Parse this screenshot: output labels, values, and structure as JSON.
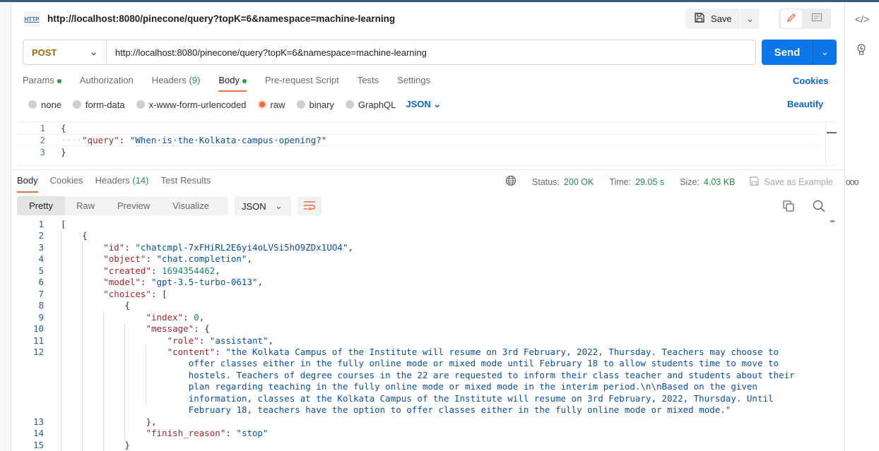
{
  "request": {
    "title": "http://localhost:8080/pinecone/query?topK=6&namespace=machine-learning",
    "method": "POST",
    "url": "http://localhost:8080/pinecone/query?topK=6&namespace=machine-learning",
    "save_label": "Save",
    "send_label": "Send",
    "tabs": [
      {
        "label": "Params",
        "dot": true
      },
      {
        "label": "Authorization"
      },
      {
        "label": "Headers",
        "count": "(9)"
      },
      {
        "label": "Body",
        "dot": true,
        "active": true
      },
      {
        "label": "Pre-request Script"
      },
      {
        "label": "Tests"
      },
      {
        "label": "Settings"
      }
    ],
    "cookies_label": "Cookies",
    "body_types": [
      "none",
      "form-data",
      "x-www-form-urlencoded",
      "raw",
      "binary",
      "GraphQL"
    ],
    "body_type_selected": "raw",
    "body_format": "JSON",
    "beautify_label": "Beautify",
    "body_lines": [
      {
        "n": "1",
        "tokens": [
          {
            "t": "{",
            "c": "p"
          }
        ]
      },
      {
        "n": "2",
        "tokens": [
          {
            "t": "····",
            "c": "g"
          },
          {
            "t": "\"query\"",
            "c": "k"
          },
          {
            "t": ": ",
            "c": "p"
          },
          {
            "t": "\"When·is·the·Kolkata·campus·opening?\"",
            "c": "s"
          }
        ]
      },
      {
        "n": "3",
        "tokens": [
          {
            "t": "}",
            "c": "p"
          }
        ]
      }
    ]
  },
  "response": {
    "tabs": [
      {
        "label": "Body",
        "active": true
      },
      {
        "label": "Cookies"
      },
      {
        "label": "Headers",
        "count": "(14)"
      },
      {
        "label": "Test Results"
      }
    ],
    "status_label": "Status:",
    "status": "200 OK",
    "time_label": "Time:",
    "time": "29.05 s",
    "size_label": "Size:",
    "size": "4.03 KB",
    "save_example_label": "Save as Example",
    "views": [
      "Pretty",
      "Raw",
      "Preview",
      "Visualize"
    ],
    "active_view": "Pretty",
    "format": "JSON",
    "lines": [
      {
        "n": "1",
        "i": 0,
        "tokens": [
          {
            "t": "[",
            "c": "p"
          }
        ]
      },
      {
        "n": "2",
        "i": 1,
        "tokens": [
          {
            "t": "{",
            "c": "p"
          }
        ]
      },
      {
        "n": "3",
        "i": 2,
        "tokens": [
          {
            "t": "\"id\"",
            "c": "k"
          },
          {
            "t": ": ",
            "c": "p"
          },
          {
            "t": "\"chatcmpl-7xFHiRL2E6yi4oLVSi5hO9ZDx1UO4\"",
            "c": "s"
          },
          {
            "t": ",",
            "c": "p"
          }
        ]
      },
      {
        "n": "4",
        "i": 2,
        "tokens": [
          {
            "t": "\"object\"",
            "c": "k"
          },
          {
            "t": ": ",
            "c": "p"
          },
          {
            "t": "\"chat.completion\"",
            "c": "s"
          },
          {
            "t": ",",
            "c": "p"
          }
        ]
      },
      {
        "n": "5",
        "i": 2,
        "tokens": [
          {
            "t": "\"created\"",
            "c": "k"
          },
          {
            "t": ": ",
            "c": "p"
          },
          {
            "t": "1694354462",
            "c": "n"
          },
          {
            "t": ",",
            "c": "p"
          }
        ]
      },
      {
        "n": "6",
        "i": 2,
        "tokens": [
          {
            "t": "\"model\"",
            "c": "k"
          },
          {
            "t": ": ",
            "c": "p"
          },
          {
            "t": "\"gpt-3.5-turbo-0613\"",
            "c": "s"
          },
          {
            "t": ",",
            "c": "p"
          }
        ]
      },
      {
        "n": "7",
        "i": 2,
        "tokens": [
          {
            "t": "\"choices\"",
            "c": "k"
          },
          {
            "t": ": [",
            "c": "p"
          }
        ]
      },
      {
        "n": "8",
        "i": 3,
        "tokens": [
          {
            "t": "{",
            "c": "p"
          }
        ]
      },
      {
        "n": "9",
        "i": 4,
        "tokens": [
          {
            "t": "\"index\"",
            "c": "k"
          },
          {
            "t": ": ",
            "c": "p"
          },
          {
            "t": "0",
            "c": "n"
          },
          {
            "t": ",",
            "c": "p"
          }
        ]
      },
      {
        "n": "10",
        "i": 4,
        "tokens": [
          {
            "t": "\"message\"",
            "c": "k"
          },
          {
            "t": ": {",
            "c": "p"
          }
        ]
      },
      {
        "n": "11",
        "i": 5,
        "tokens": [
          {
            "t": "\"role\"",
            "c": "k"
          },
          {
            "t": ": ",
            "c": "p"
          },
          {
            "t": "\"assistant\"",
            "c": "s"
          },
          {
            "t": ",",
            "c": "p"
          }
        ]
      },
      {
        "n": "12",
        "i": 5,
        "tokens": [
          {
            "t": "\"content\"",
            "c": "k"
          },
          {
            "t": ": ",
            "c": "p"
          },
          {
            "t": "\"the Kolkata Campus of the Institute will resume on 3rd February, 2022, Thursday. Teachers may choose to",
            "c": "s"
          }
        ]
      },
      {
        "n": "",
        "i": 6,
        "tokens": [
          {
            "t": "offer classes either in the fully online mode or mixed mode until February 18 to allow students time to move to",
            "c": "s"
          }
        ]
      },
      {
        "n": "",
        "i": 6,
        "tokens": [
          {
            "t": "hostels. Teachers of degree courses in the 22 are requested to inform their class teacher and students about their",
            "c": "s"
          }
        ]
      },
      {
        "n": "",
        "i": 6,
        "tokens": [
          {
            "t": "plan regarding teaching in the fully online mode or mixed mode in the interim period.\\n\\nBased on the given",
            "c": "s"
          }
        ]
      },
      {
        "n": "",
        "i": 6,
        "tokens": [
          {
            "t": "information, classes at the Kolkata Campus of the Institute will resume on 3rd February, 2022, Thursday. Until",
            "c": "s"
          }
        ]
      },
      {
        "n": "",
        "i": 6,
        "tokens": [
          {
            "t": "February 18, teachers have the option to offer classes either in the fully online mode or mixed mode.\"",
            "c": "s"
          }
        ]
      },
      {
        "n": "13",
        "i": 4,
        "tokens": [
          {
            "t": "},",
            "c": "p"
          }
        ]
      },
      {
        "n": "14",
        "i": 4,
        "tokens": [
          {
            "t": "\"finish_reason\"",
            "c": "k"
          },
          {
            "t": ": ",
            "c": "p"
          },
          {
            "t": "\"stop\"",
            "c": "s"
          }
        ]
      },
      {
        "n": "15",
        "i": 3,
        "tokens": [
          {
            "t": "}",
            "c": "p"
          }
        ]
      }
    ]
  },
  "colors": {
    "accent": "#f26b3a",
    "send": "#0c75e8",
    "link": "#0c65d6",
    "status_ok": "#1f8e4e"
  }
}
